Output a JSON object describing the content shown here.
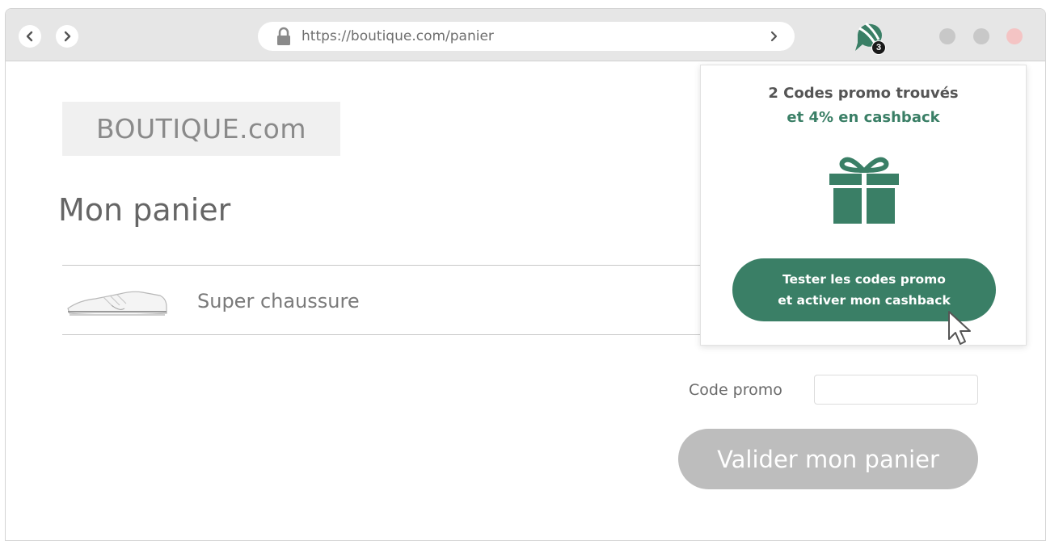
{
  "browser": {
    "url": "https://boutique.com/panier",
    "extension_badge": "3"
  },
  "page": {
    "logo": "BOUTIQUE.com",
    "title": "Mon panier",
    "product_name": "Super chaussure",
    "promo_label": "Code promo",
    "promo_value": "",
    "validate_label": "Valider mon panier"
  },
  "popup": {
    "title": "2 Codes promo trouvés",
    "subtitle": "et 4% en cashback",
    "cta_line1": "Tester les codes promo",
    "cta_line2": "et activer mon cashback"
  },
  "colors": {
    "accent": "#3a7f66",
    "disabled_button": "#bdbdbd"
  },
  "icons": [
    "back-icon",
    "forward-icon",
    "lock-icon",
    "go-icon",
    "extension-chat-icon",
    "gift-icon",
    "cursor-icon"
  ]
}
